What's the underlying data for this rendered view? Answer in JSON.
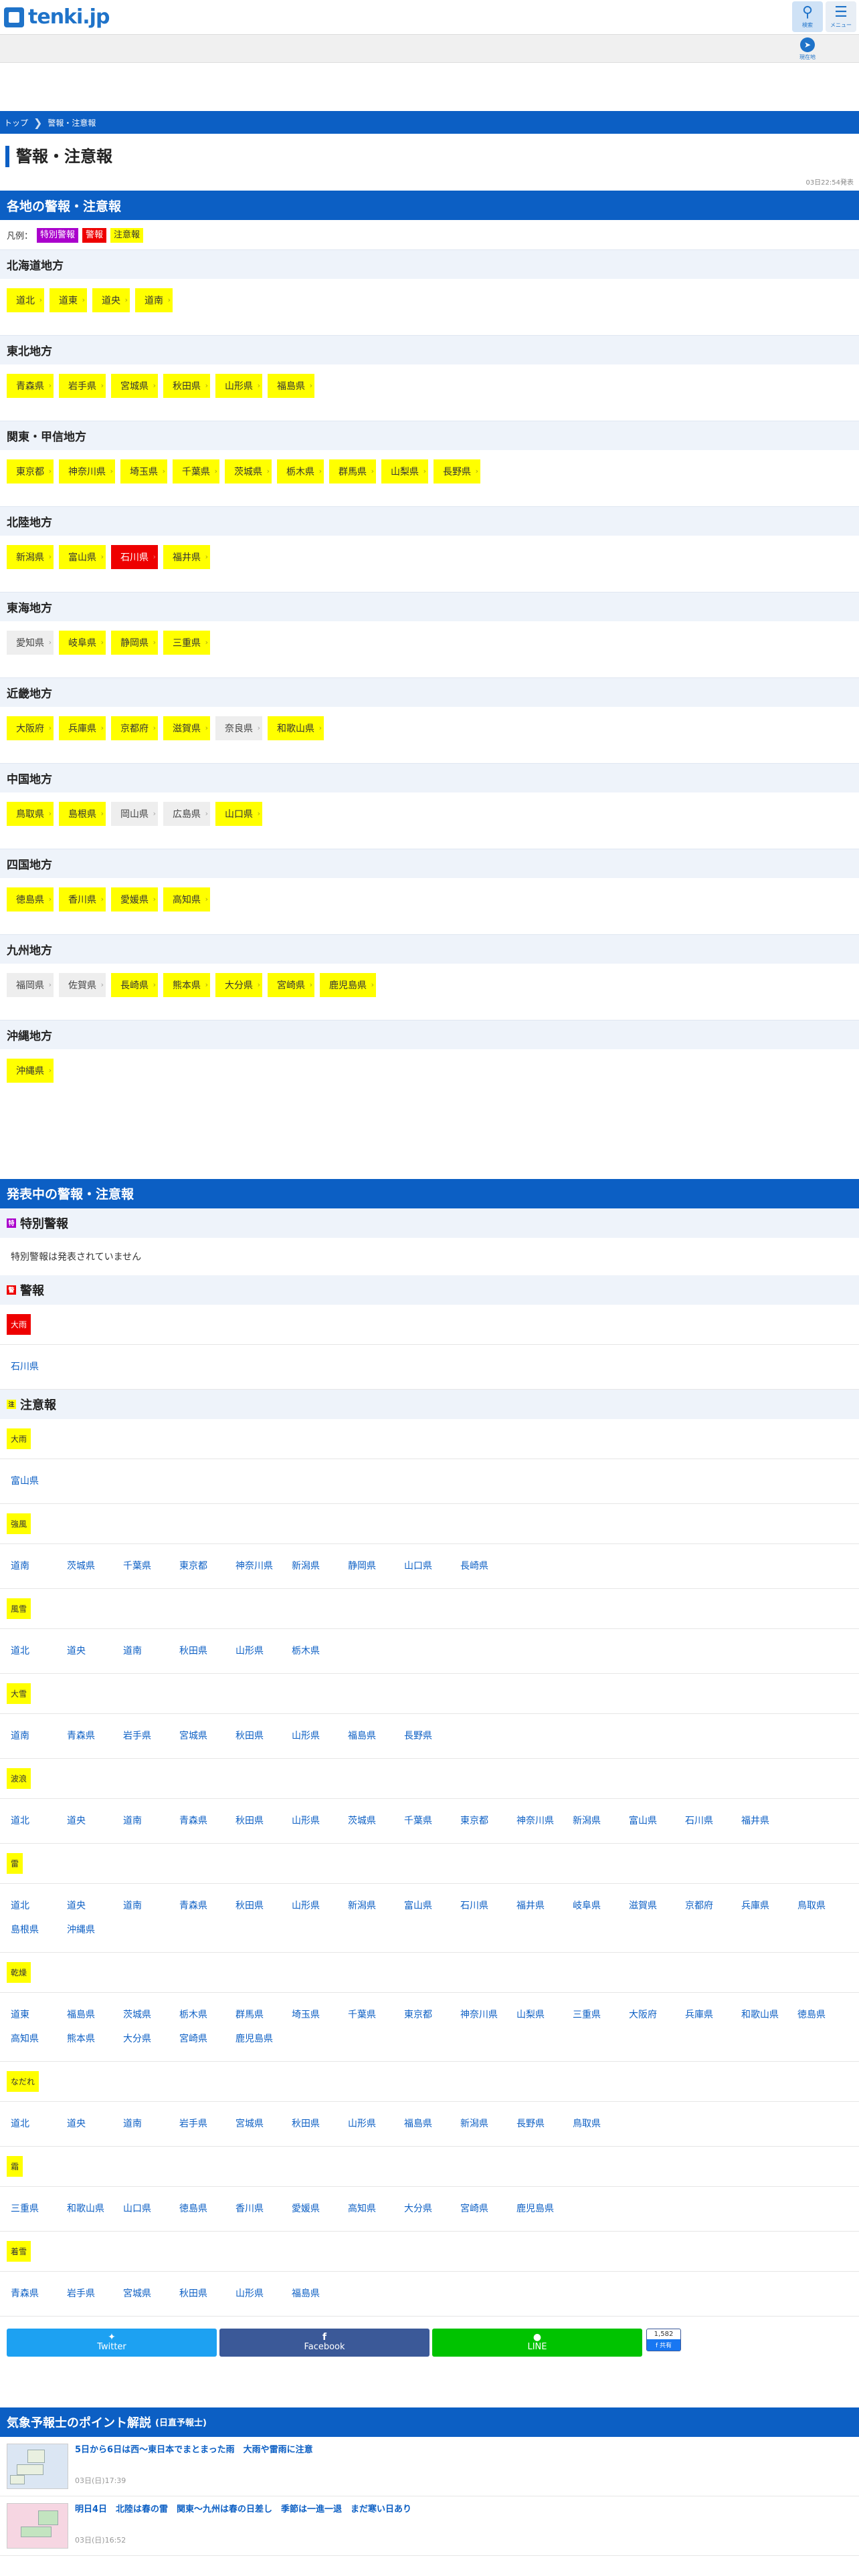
{
  "header": {
    "logo_text": "tenki.jp",
    "search_label": "検索",
    "menu_label": "メニュー",
    "location_label": "現在地"
  },
  "breadcrumb": [
    "トップ",
    "警報・注意報"
  ],
  "page_title": "警報・注意報",
  "announce_time": "03日22:54発表",
  "regional_section_title": "各地の警報・注意報",
  "legend": {
    "prefix": "凡例：",
    "special": "特別警報",
    "warning": "警報",
    "advisory": "注意報"
  },
  "regions": [
    {
      "name": "北海道地方",
      "prefs": [
        {
          "name": "道北",
          "level": "advisory"
        },
        {
          "name": "道東",
          "level": "advisory"
        },
        {
          "name": "道央",
          "level": "advisory"
        },
        {
          "name": "道南",
          "level": "advisory"
        }
      ]
    },
    {
      "name": "東北地方",
      "prefs": [
        {
          "name": "青森県",
          "level": "advisory"
        },
        {
          "name": "岩手県",
          "level": "advisory"
        },
        {
          "name": "宮城県",
          "level": "advisory"
        },
        {
          "name": "秋田県",
          "level": "advisory"
        },
        {
          "name": "山形県",
          "level": "advisory"
        },
        {
          "name": "福島県",
          "level": "advisory"
        }
      ]
    },
    {
      "name": "関東・甲信地方",
      "prefs": [
        {
          "name": "東京都",
          "level": "advisory"
        },
        {
          "name": "神奈川県",
          "level": "advisory"
        },
        {
          "name": "埼玉県",
          "level": "advisory"
        },
        {
          "name": "千葉県",
          "level": "advisory"
        },
        {
          "name": "茨城県",
          "level": "advisory"
        },
        {
          "name": "栃木県",
          "level": "advisory"
        },
        {
          "name": "群馬県",
          "level": "advisory"
        },
        {
          "name": "山梨県",
          "level": "advisory"
        },
        {
          "name": "長野県",
          "level": "advisory"
        }
      ]
    },
    {
      "name": "北陸地方",
      "prefs": [
        {
          "name": "新潟県",
          "level": "advisory"
        },
        {
          "name": "富山県",
          "level": "advisory"
        },
        {
          "name": "石川県",
          "level": "warning"
        },
        {
          "name": "福井県",
          "level": "advisory"
        }
      ]
    },
    {
      "name": "東海地方",
      "prefs": [
        {
          "name": "愛知県",
          "level": "none"
        },
        {
          "name": "岐阜県",
          "level": "advisory"
        },
        {
          "name": "静岡県",
          "level": "advisory"
        },
        {
          "name": "三重県",
          "level": "advisory"
        }
      ]
    },
    {
      "name": "近畿地方",
      "prefs": [
        {
          "name": "大阪府",
          "level": "advisory"
        },
        {
          "name": "兵庫県",
          "level": "advisory"
        },
        {
          "name": "京都府",
          "level": "advisory"
        },
        {
          "name": "滋賀県",
          "level": "advisory"
        },
        {
          "name": "奈良県",
          "level": "none"
        },
        {
          "name": "和歌山県",
          "level": "advisory"
        }
      ]
    },
    {
      "name": "中国地方",
      "prefs": [
        {
          "name": "鳥取県",
          "level": "advisory"
        },
        {
          "name": "島根県",
          "level": "advisory"
        },
        {
          "name": "岡山県",
          "level": "none"
        },
        {
          "name": "広島県",
          "level": "none"
        },
        {
          "name": "山口県",
          "level": "advisory"
        }
      ]
    },
    {
      "name": "四国地方",
      "prefs": [
        {
          "name": "徳島県",
          "level": "advisory"
        },
        {
          "name": "香川県",
          "level": "advisory"
        },
        {
          "name": "愛媛県",
          "level": "advisory"
        },
        {
          "name": "高知県",
          "level": "advisory"
        }
      ]
    },
    {
      "name": "九州地方",
      "prefs": [
        {
          "name": "福岡県",
          "level": "none"
        },
        {
          "name": "佐賀県",
          "level": "none"
        },
        {
          "name": "長崎県",
          "level": "advisory"
        },
        {
          "name": "熊本県",
          "level": "advisory"
        },
        {
          "name": "大分県",
          "level": "advisory"
        },
        {
          "name": "宮崎県",
          "level": "advisory"
        },
        {
          "name": "鹿児島県",
          "level": "advisory"
        }
      ]
    },
    {
      "name": "沖縄地方",
      "prefs": [
        {
          "name": "沖縄県",
          "level": "advisory"
        }
      ]
    }
  ],
  "current_section_title": "発表中の警報・注意報",
  "special": {
    "title": "特別警報",
    "icon_char": "特",
    "none_text": "特別警報は発表されていません"
  },
  "warning": {
    "title": "警報",
    "icon_char": "警",
    "hazards": [
      {
        "name": "大雨",
        "prefs": [
          "石川県"
        ]
      }
    ]
  },
  "advisory": {
    "title": "注意報",
    "icon_char": "注",
    "hazards": [
      {
        "name": "大雨",
        "prefs": [
          "富山県"
        ]
      },
      {
        "name": "強風",
        "prefs": [
          "道南",
          "茨城県",
          "千葉県",
          "東京都",
          "神奈川県",
          "新潟県",
          "静岡県",
          "山口県",
          "長崎県"
        ]
      },
      {
        "name": "風雪",
        "prefs": [
          "道北",
          "道央",
          "道南",
          "秋田県",
          "山形県",
          "栃木県"
        ]
      },
      {
        "name": "大雪",
        "prefs": [
          "道南",
          "青森県",
          "岩手県",
          "宮城県",
          "秋田県",
          "山形県",
          "福島県",
          "長野県"
        ]
      },
      {
        "name": "波浪",
        "prefs": [
          "道北",
          "道央",
          "道南",
          "青森県",
          "秋田県",
          "山形県",
          "茨城県",
          "千葉県",
          "東京都",
          "神奈川県",
          "新潟県",
          "富山県",
          "石川県",
          "福井県"
        ]
      },
      {
        "name": "雷",
        "prefs": [
          "道北",
          "道央",
          "道南",
          "青森県",
          "秋田県",
          "山形県",
          "新潟県",
          "富山県",
          "石川県",
          "福井県",
          "岐阜県",
          "滋賀県",
          "京都府",
          "兵庫県",
          "鳥取県",
          "島根県",
          "沖縄県"
        ]
      },
      {
        "name": "乾燥",
        "prefs": [
          "道東",
          "福島県",
          "茨城県",
          "栃木県",
          "群馬県",
          "埼玉県",
          "千葉県",
          "東京都",
          "神奈川県",
          "山梨県",
          "三重県",
          "大阪府",
          "兵庫県",
          "和歌山県",
          "徳島県",
          "高知県",
          "熊本県",
          "大分県",
          "宮崎県",
          "鹿児島県"
        ]
      },
      {
        "name": "なだれ",
        "prefs": [
          "道北",
          "道央",
          "道南",
          "岩手県",
          "宮城県",
          "秋田県",
          "山形県",
          "福島県",
          "新潟県",
          "長野県",
          "鳥取県"
        ]
      },
      {
        "name": "霜",
        "prefs": [
          "三重県",
          "和歌山県",
          "山口県",
          "徳島県",
          "香川県",
          "愛媛県",
          "高知県",
          "大分県",
          "宮崎県",
          "鹿児島県"
        ]
      },
      {
        "name": "着雪",
        "prefs": [
          "青森県",
          "岩手県",
          "宮城県",
          "秋田県",
          "山形県",
          "福島県"
        ]
      }
    ]
  },
  "share": {
    "twitter": "Twitter",
    "facebook": "Facebook",
    "line": "LINE",
    "fb_count": "1,582",
    "fb_count_label": "f 共有"
  },
  "points": {
    "title": "気象予報士のポイント解説",
    "subtitle": "(日直予報士)",
    "articles": [
      {
        "title": "5日から6日は西～東日本でまとまった雨　大雨や雷雨に注意",
        "date": "03日(日)17:39"
      },
      {
        "title": "明日4日　北陸は春の雷　関東～九州は春の日差し　季節は一進一退　まだ寒い日あり",
        "date": "03日(日)16:52"
      }
    ]
  },
  "colors": {
    "brand_blue": "#0c5fc4",
    "advisory_yellow": "#ffff00",
    "warning_red": "#ee0000",
    "special_purple": "#aa00cc",
    "none_gray": "#eeeeee"
  }
}
